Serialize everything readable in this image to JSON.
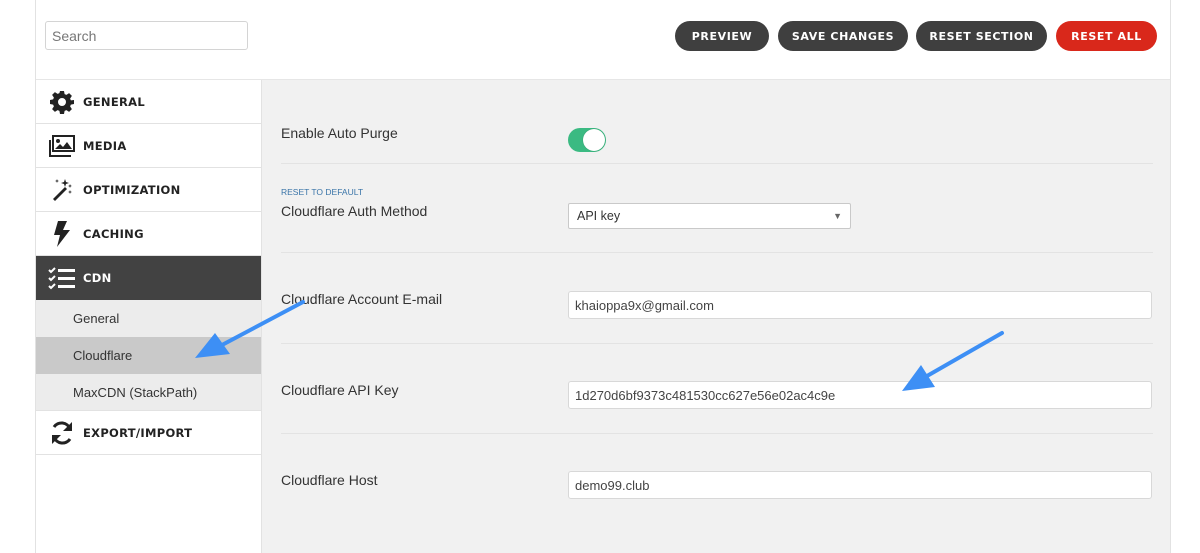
{
  "search": {
    "placeholder": "Search"
  },
  "toolbar": {
    "preview_label": "Preview",
    "save_label": "Save Changes",
    "reset_section_label": "Reset Section",
    "reset_all_label": "Reset All"
  },
  "sidebar": {
    "items": [
      {
        "label": "GENERAL",
        "icon": "gear-icon"
      },
      {
        "label": "MEDIA",
        "icon": "images-icon"
      },
      {
        "label": "OPTIMIZATION",
        "icon": "magic-wand-icon"
      },
      {
        "label": "CACHING",
        "icon": "bolt-icon"
      },
      {
        "label": "CDN",
        "icon": "checklist-icon",
        "active": true
      },
      {
        "label": "EXPORT/IMPORT",
        "icon": "sync-icon"
      }
    ],
    "cdn_subitems": [
      {
        "label": "General"
      },
      {
        "label": "Cloudflare",
        "selected": true
      },
      {
        "label": "MaxCDN (StackPath)"
      }
    ]
  },
  "main": {
    "auto_purge": {
      "label": "Enable Auto Purge",
      "enabled": true
    },
    "auth_method": {
      "reset_link": "RESET TO DEFAULT",
      "label": "Cloudflare Auth Method",
      "value": "API key"
    },
    "email": {
      "label": "Cloudflare Account E-mail",
      "value": "khaioppa9x@gmail.com"
    },
    "api_key": {
      "label": "Cloudflare API Key",
      "value": "1d270d6bf9373c481530cc627e56e02ac4c9e"
    },
    "host": {
      "label": "Cloudflare Host",
      "value": "demo99.club"
    }
  },
  "colors": {
    "accent_toggle": "#3bba82",
    "reset_all": "#d9281b",
    "dark_button": "#3f3f3f",
    "active_nav": "#424242",
    "annotation_arrow": "#3d8ff5"
  }
}
